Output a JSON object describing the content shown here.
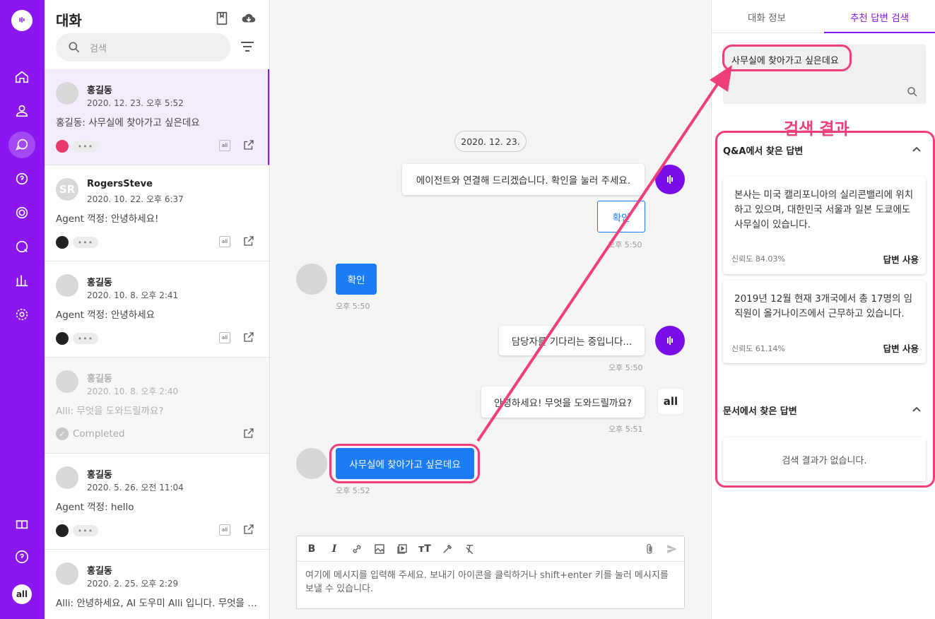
{
  "colors": {
    "brand": "#8a16f0",
    "accent_blue": "#1b7cf6",
    "annotation": "#ee3f7a"
  },
  "rail": {
    "icons": [
      "chat-bubble-icon",
      "home-icon",
      "user-icon",
      "conversation-icon",
      "help-bubble-icon",
      "target-icon",
      "search-chat-icon",
      "bar-chart-icon",
      "gear-icon",
      "gift-icon",
      "help-circle-icon"
    ],
    "avatar_label": "all"
  },
  "list": {
    "title": "대화",
    "search_placeholder": "검색",
    "conversations": [
      {
        "avatar": "",
        "name": "홍길동",
        "date": "2020. 12. 23. 오후 5:52",
        "preview": "홍길동: 사무실에 찾아가고 싶은데요",
        "status": "active"
      },
      {
        "avatar": "SR",
        "name": "RogersSteve",
        "date": "2020. 10. 22. 오후 6:37",
        "preview": "Agent 꺽정: 안녕하세요!",
        "status": "active"
      },
      {
        "avatar": "",
        "name": "홍길동",
        "date": "2020. 10. 8. 오후 2:41",
        "preview": "Agent 꺽정: 안녕하세요",
        "status": "active"
      },
      {
        "avatar": "",
        "name": "홍길동",
        "date": "2020. 10. 8. 오후 2:40",
        "preview": "Alli: 무엇을 도와드릴까요?",
        "status": "completed",
        "status_label": "Completed"
      },
      {
        "avatar": "",
        "name": "홍길동",
        "date": "2020. 5. 26. 오전 11:04",
        "preview": "Agent 꺽정: hello",
        "status": "active"
      },
      {
        "avatar": "",
        "name": "홍길동",
        "date": "2020. 2. 25. 오후 2:29",
        "preview": "Alli: 안녕하세요, AI 도우미 Alli 입니다. 무엇을 …",
        "status": "active"
      }
    ],
    "dots": "•••",
    "icon_label": "all"
  },
  "chat": {
    "date_chip": "2020. 12. 23.",
    "msg_agent_connect": "에이전트와 연결해 드리겠습니다. 확인을 눌러 주세요.",
    "btn_confirm": "확인",
    "time_1": "오후 5:50",
    "user_confirm": "확인",
    "time_2": "오후 5:50",
    "msg_waiting": "담당자를 기다리는 중입니다...",
    "time_3": "오후 5:50",
    "msg_greeting": "안녕하세요! 무엇을 도와드릴까요?",
    "time_4": "오후 5:51",
    "user_msg": "사무실에 찾아가고 싶은데요",
    "time_5": "오후 5:52",
    "alli_label": "all",
    "composer_placeholder": "여기에 메시지를 입력해 주세요. 보내기 아이콘을 클릭하거나 shift+enter 키를 눌러 메시지를 보낼 수 있습니다.",
    "toolbar": {
      "bold": "B",
      "italic": "I",
      "text_size": "тT"
    }
  },
  "panel": {
    "tab_info": "대화 정보",
    "tab_search": "추천 답변 검색",
    "query": "사무실에 찾아가고 싶은데요",
    "annotation_title": "검색 결과",
    "qa_title": "Q&A에서 찾은 답변",
    "answers": [
      {
        "text": "본사는 미국 캘리포니아의 실리콘밸리에 위치하고 있으며, 대한민국 서울과 일본 도쿄에도 사무실이 있습니다.",
        "confidence": "신뢰도 84.03%",
        "use": "답변 사용"
      },
      {
        "text": "2019년 12월 현재 3개국에서 총 17명의 임직원이 올거나이즈에서 근무하고 있습니다.",
        "confidence": "신뢰도 61.14%",
        "use": "답변 사용"
      }
    ],
    "doc_title": "문서에서 찾은 답변",
    "no_result": "검색 결과가 없습니다."
  }
}
